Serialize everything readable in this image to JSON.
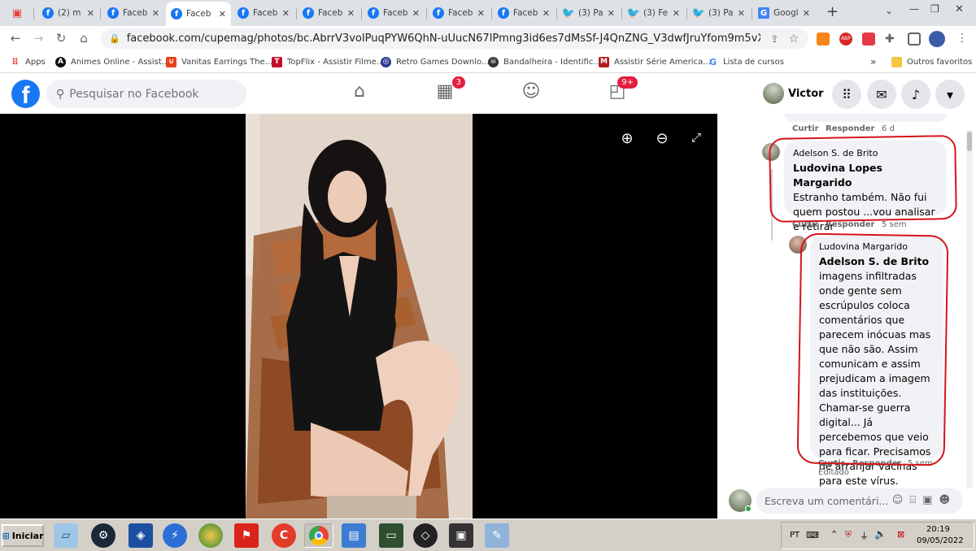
{
  "tabs": [
    {
      "title": "(2) m",
      "favicon": "facebook",
      "active": false
    },
    {
      "title": "Faceb",
      "favicon": "facebook",
      "active": false
    },
    {
      "title": "Faceb",
      "favicon": "facebook",
      "active": true
    },
    {
      "title": "Faceb",
      "favicon": "facebook",
      "active": false
    },
    {
      "title": "Faceb",
      "favicon": "facebook",
      "active": false
    },
    {
      "title": "Faceb",
      "favicon": "facebook",
      "active": false
    },
    {
      "title": "Faceb",
      "favicon": "facebook",
      "active": false
    },
    {
      "title": "Faceb",
      "favicon": "facebook",
      "active": false
    },
    {
      "title": "(3) Pa",
      "favicon": "twitter",
      "active": false
    },
    {
      "title": "(3) Fe",
      "favicon": "twitter",
      "active": false
    },
    {
      "title": "(3) Pa",
      "favicon": "twitter",
      "active": false
    },
    {
      "title": "Googl",
      "favicon": "google-translate",
      "active": false
    }
  ],
  "browser": {
    "url": "facebook.com/cupemag/photos/bc.AbrrV3voIPuqPYW6QhN-uUucN67lPmng3id6es7dMsSf-J4QnZNG_V3dwfJruYfom9m5vX0xWv6vrZB9d0IS...",
    "new_tab": "+"
  },
  "bookmarks": [
    {
      "label": "Apps",
      "color": "#e94235"
    },
    {
      "label": "Animes Online - Assist...",
      "color": "#111111"
    },
    {
      "label": "Vanitas Earrings The...",
      "color": "#e84118"
    },
    {
      "label": "TopFlix - Assistir Filme...",
      "color": "#c0102a"
    },
    {
      "label": "Retro Games Downlo...",
      "color": "#2b3a8c"
    },
    {
      "label": "Bandalheira - Identific...",
      "color": "#333333"
    },
    {
      "label": "Assistir Série America...",
      "color": "#b01c1c"
    },
    {
      "label": "Lista de cursos",
      "color": "#4285f4"
    },
    {
      "label": "»",
      "color": ""
    },
    {
      "label": "Outros favoritos",
      "color": "#f2c744"
    }
  ],
  "facebook": {
    "search_placeholder": "Pesquisar no Facebook",
    "badge_marketplace": "3",
    "badge_gaming": "9+",
    "user_name": "Victor"
  },
  "comments": {
    "top_actions": {
      "like": "Curtir",
      "reply": "Responder",
      "time": "6 d"
    },
    "comment1": {
      "author": "Adelson S. de Brito",
      "mention": "Ludovina Lopes Margarido",
      "text": "Estranho também. Não fui quem postou ...vou analisar e retirar",
      "like": "Curtir",
      "reply": "Responder",
      "time": "5 sem"
    },
    "comment2": {
      "author": "Ludovina Margarido",
      "mention": "Adelson S. de Brito",
      "text": "imagens infiltradas onde gente sem escrúpulos coloca comentários que parecem inócuas mas que não são. Assim comunicam e assim prejudicam a imagem das instituições. Chamar-se guerra digital... Já percebemos que veio para ficar. Precisamos de arranjar vacinas para este vírus.",
      "like": "Curtir",
      "reply": "Responder",
      "time": "5 sem",
      "edited": "Editado"
    },
    "compose_placeholder": "Escreva um comentári..."
  },
  "taskbar": {
    "start_label": "Iniciar",
    "language": "PT",
    "time": "20:19",
    "date": "09/05/2022"
  },
  "colors": {
    "facebook_blue": "#1877f2",
    "badge_red": "#e41e3f",
    "annotation_red": "#d4141b"
  }
}
